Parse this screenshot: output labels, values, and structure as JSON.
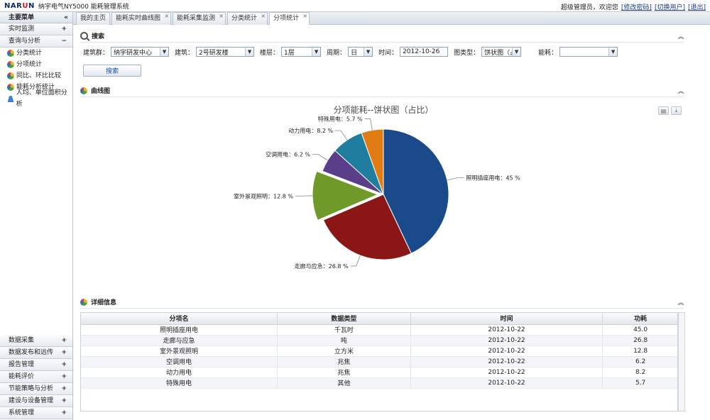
{
  "app": {
    "logo_main": "NAR",
    "logo_accent": "U",
    "logo_tail": "N",
    "title": "纳宇电气NY5000 能耗管理系统"
  },
  "user_bar": {
    "greeting": "超级管理员，欢迎您",
    "change_password": "[修改密码]",
    "switch_user": "[切换用户]",
    "logout": "[退出]"
  },
  "sidebar": {
    "header": "主要菜单",
    "collapse_icon": "«",
    "sections_top": [
      {
        "label": "实时监测",
        "toggle": "+"
      },
      {
        "label": "查询与分析",
        "toggle": "−"
      }
    ],
    "items": [
      {
        "label": "分类统计",
        "icon": "chart-icon"
      },
      {
        "label": "分项统计",
        "icon": "chart-icon"
      },
      {
        "label": "同比、环比比较",
        "icon": "chart-icon"
      },
      {
        "label": "能耗分析统计",
        "icon": "chart-icon"
      },
      {
        "label": "人均、单位面积分析",
        "icon": "user-icon"
      }
    ],
    "sections_bottom": [
      {
        "label": "数据采集",
        "toggle": "+"
      },
      {
        "label": "数据发布和远传",
        "toggle": "+"
      },
      {
        "label": "报告管理",
        "toggle": "+"
      },
      {
        "label": "能耗评价",
        "toggle": "+"
      },
      {
        "label": "节能策略与分析",
        "toggle": "+"
      },
      {
        "label": "建设与设备管理",
        "toggle": "+"
      },
      {
        "label": "系统管理",
        "toggle": "+"
      }
    ]
  },
  "tabs": [
    {
      "label": "我的主页",
      "closable": false
    },
    {
      "label": "能耗实时曲线图",
      "closable": true
    },
    {
      "label": "能耗采集监测",
      "closable": true
    },
    {
      "label": "分类统计",
      "closable": true
    },
    {
      "label": "分项统计",
      "closable": true,
      "active": true
    }
  ],
  "search": {
    "heading": "搜索",
    "building_group_label": "建筑群：",
    "building_group_value": "纳宇研发中心",
    "building_label": "建筑：",
    "building_value": "2号研发楼",
    "floor_label": "楼层：",
    "floor_value": "1层",
    "period_label": "周期：",
    "period_value": "日",
    "time_label": "时间：",
    "time_value": "2012-10-26",
    "chart_type_label": "图类型：",
    "chart_type_value": "饼状图（占",
    "energy_label": "能耗：",
    "energy_value": "",
    "button": "搜索"
  },
  "chart_panel": {
    "heading": "曲线图"
  },
  "chart_data": {
    "type": "pie",
    "title": "分项能耗--饼状图（占比）",
    "slices": [
      {
        "name": "照明插座用电",
        "value": 45,
        "label": "照明插座用电：45 %",
        "color": "#1a4a8a"
      },
      {
        "name": "走廊与应急",
        "value": 26.8,
        "label": "走廊与应急：26.8 %",
        "color": "#8a1616"
      },
      {
        "name": "室外景观照明",
        "value": 12.8,
        "label": "室外景观照明：12.8 %",
        "color": "#6f9a2a",
        "exploded": true
      },
      {
        "name": "空调用电",
        "value": 6.2,
        "label": "空调用电：6.2 %",
        "color": "#5a3e8a"
      },
      {
        "name": "动力用电",
        "value": 8.2,
        "label": "动力用电：8.2 %",
        "color": "#1f7ea0"
      },
      {
        "name": "特殊用电",
        "value": 5.7,
        "label": "特殊用电：5.7 %",
        "color": "#e07c14"
      }
    ]
  },
  "detail": {
    "heading": "详细信息",
    "columns": [
      "分项名",
      "数据类型",
      "时间",
      "功耗"
    ],
    "rows": [
      [
        "照明插座用电",
        "千瓦时",
        "2012-10-22",
        "45.0"
      ],
      [
        "走廊与应急",
        "吨",
        "2012-10-22",
        "26.8"
      ],
      [
        "室外景观照明",
        "立方米",
        "2012-10-22",
        "12.8"
      ],
      [
        "空调用电",
        "兆焦",
        "2012-10-22",
        "6.2"
      ],
      [
        "动力用电",
        "兆焦",
        "2012-10-22",
        "8.2"
      ],
      [
        "特殊用电",
        "其他",
        "2012-10-22",
        "5.7"
      ]
    ]
  }
}
